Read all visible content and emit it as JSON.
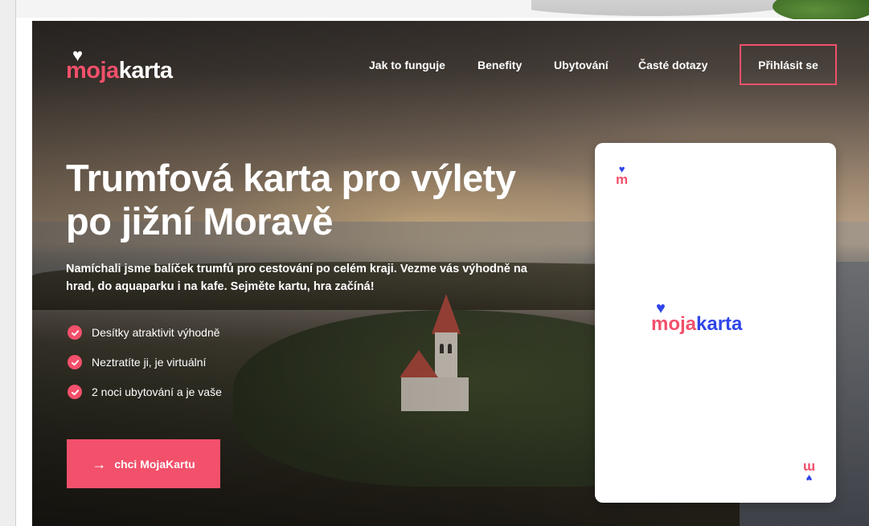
{
  "brand": {
    "heart_glyph": "♥",
    "name_part1": "moja",
    "name_part2": "karta",
    "accent_color": "#f2506b",
    "secondary_color": "#2f45e8"
  },
  "nav": {
    "items": [
      {
        "label": "Jak to funguje"
      },
      {
        "label": "Benefity"
      },
      {
        "label": "Ubytování"
      },
      {
        "label": "Časté dotazy"
      }
    ],
    "login_label": "Přihlásit se"
  },
  "hero": {
    "headline_line1": "Trumfová karta pro výlety",
    "headline_line2": "po jižní Moravě",
    "subhead": "Namíchali jsme balíček trumfů pro cestování po celém kraji. Vezme vás výhodně na hrad, do aquaparku i na kafe. Sejměte kartu, hra začíná!",
    "features": [
      {
        "text": "Desítky atraktivit výhodně",
        "icon": "check-icon"
      },
      {
        "text": "Neztratíte ji, je virtuální",
        "icon": "check-icon"
      },
      {
        "text": "2 noci ubytování a je vaše",
        "icon": "check-icon"
      }
    ],
    "cta": {
      "arrow": "→",
      "label": "chci MojaKartu"
    }
  },
  "card": {
    "corner_suit": "♥",
    "corner_rank": "m",
    "heart_glyph": "♥",
    "name_part1": "moja",
    "name_part2": "karta"
  }
}
